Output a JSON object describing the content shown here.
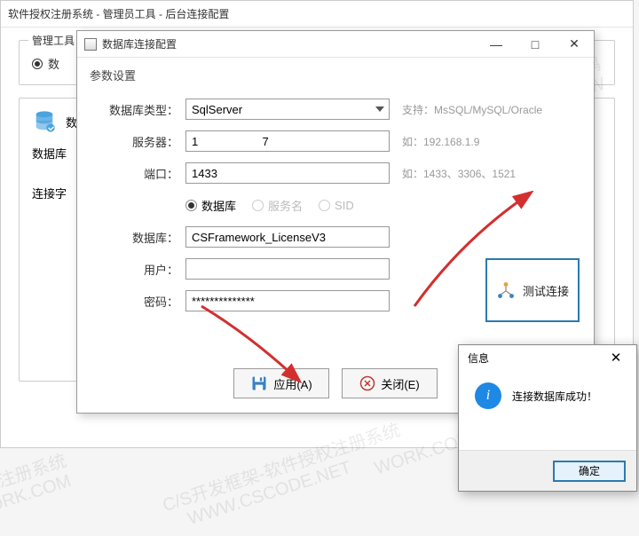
{
  "bg": {
    "title": "软件授权注册系统 - 管理员工具 - 后台连接配置",
    "group_title": "管理工具",
    "radio_label": "数",
    "db_section_label": "数据",
    "field_dbtype": "数据库",
    "field_connstr": "连接字"
  },
  "dialog": {
    "title": "数据库连接配置",
    "section": "参数设置",
    "labels": {
      "dbtype": "数据库类型：",
      "server": "服务器：",
      "port": "端口：",
      "database": "数据库：",
      "user": "用户：",
      "password": "密码："
    },
    "values": {
      "dbtype": "SqlServer",
      "server": "1                    7",
      "port": "1433",
      "database": "CSFramework_LicenseV3",
      "user": "",
      "password": "**************"
    },
    "hints": {
      "dbtype": "支持：MsSQL/MySQL/Oracle",
      "server": "如：192.168.1.9",
      "port": "如：1433、3306、1521"
    },
    "radios": {
      "db": "数据库",
      "svc": "服务名",
      "sid": "SID"
    },
    "test_btn": "测试连接",
    "apply_btn": "应用(A)",
    "close_btn": "关闭(E)"
  },
  "msgbox": {
    "title": "信息",
    "text": "连接数据库成功！",
    "ok": "确定"
  }
}
